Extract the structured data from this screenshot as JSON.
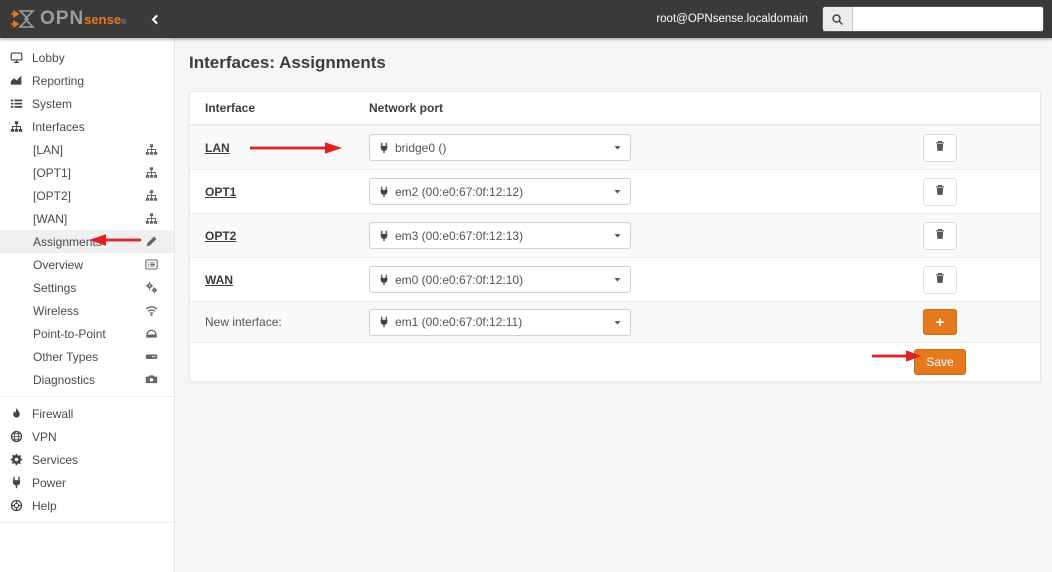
{
  "navbar": {
    "logo": {
      "opn": "OPN",
      "sense": "sense",
      "reg": "®"
    },
    "username": "root@OPNsense.localdomain",
    "search_placeholder": ""
  },
  "sidebar": {
    "top": [
      {
        "label": "Lobby",
        "icon": "desktop-icon"
      },
      {
        "label": "Reporting",
        "icon": "area-chart-icon"
      },
      {
        "label": "System",
        "icon": "list-icon"
      },
      {
        "label": "Interfaces",
        "icon": "sitemap-icon"
      }
    ],
    "interfaces_submenu": [
      {
        "label": "[LAN]",
        "icon": "sitemap-icon"
      },
      {
        "label": "[OPT1]",
        "icon": "sitemap-icon"
      },
      {
        "label": "[OPT2]",
        "icon": "sitemap-icon"
      },
      {
        "label": "[WAN]",
        "icon": "sitemap-icon"
      },
      {
        "label": "Assignments",
        "icon": "pencil-icon",
        "active": true
      },
      {
        "label": "Overview",
        "icon": "list-alt-icon"
      },
      {
        "label": "Settings",
        "icon": "cogs-icon"
      },
      {
        "label": "Wireless",
        "icon": "wifi-icon"
      },
      {
        "label": "Point-to-Point",
        "icon": "modem-icon"
      },
      {
        "label": "Other Types",
        "icon": "hdd-icon"
      },
      {
        "label": "Diagnostics",
        "icon": "diagnostics-icon"
      }
    ],
    "bottom": [
      {
        "label": "Firewall",
        "icon": "fire-icon"
      },
      {
        "label": "VPN",
        "icon": "globe-icon"
      },
      {
        "label": "Services",
        "icon": "gear-icon"
      },
      {
        "label": "Power",
        "icon": "plug-icon"
      },
      {
        "label": "Help",
        "icon": "life-ring-icon"
      }
    ]
  },
  "main": {
    "title": "Interfaces: Assignments",
    "table": {
      "headers": {
        "interface": "Interface",
        "network_port": "Network port"
      },
      "rows": [
        {
          "interface": "LAN",
          "port": "bridge0 ()"
        },
        {
          "interface": "OPT1",
          "port": "em2 (00:e0:67:0f:12:12)"
        },
        {
          "interface": "OPT2",
          "port": "em3 (00:e0:67:0f:12:13)"
        },
        {
          "interface": "WAN",
          "port": "em0 (00:e0:67:0f:12:10)"
        }
      ],
      "new_row": {
        "label": "New interface:",
        "port": "em1 (00:e0:67:0f:12:11)"
      },
      "add_label": "+",
      "save_label": "Save"
    }
  },
  "colors": {
    "accent_orange": "#e5791e",
    "accent_orange_border": "#cf6a15",
    "navbar_bg": "#3b3a39",
    "annotation_red": "#df2228",
    "content_bg": "#f6f6f6",
    "stripe_bg": "#f9f9f9",
    "sidebar_active_bg": "#efefef"
  }
}
